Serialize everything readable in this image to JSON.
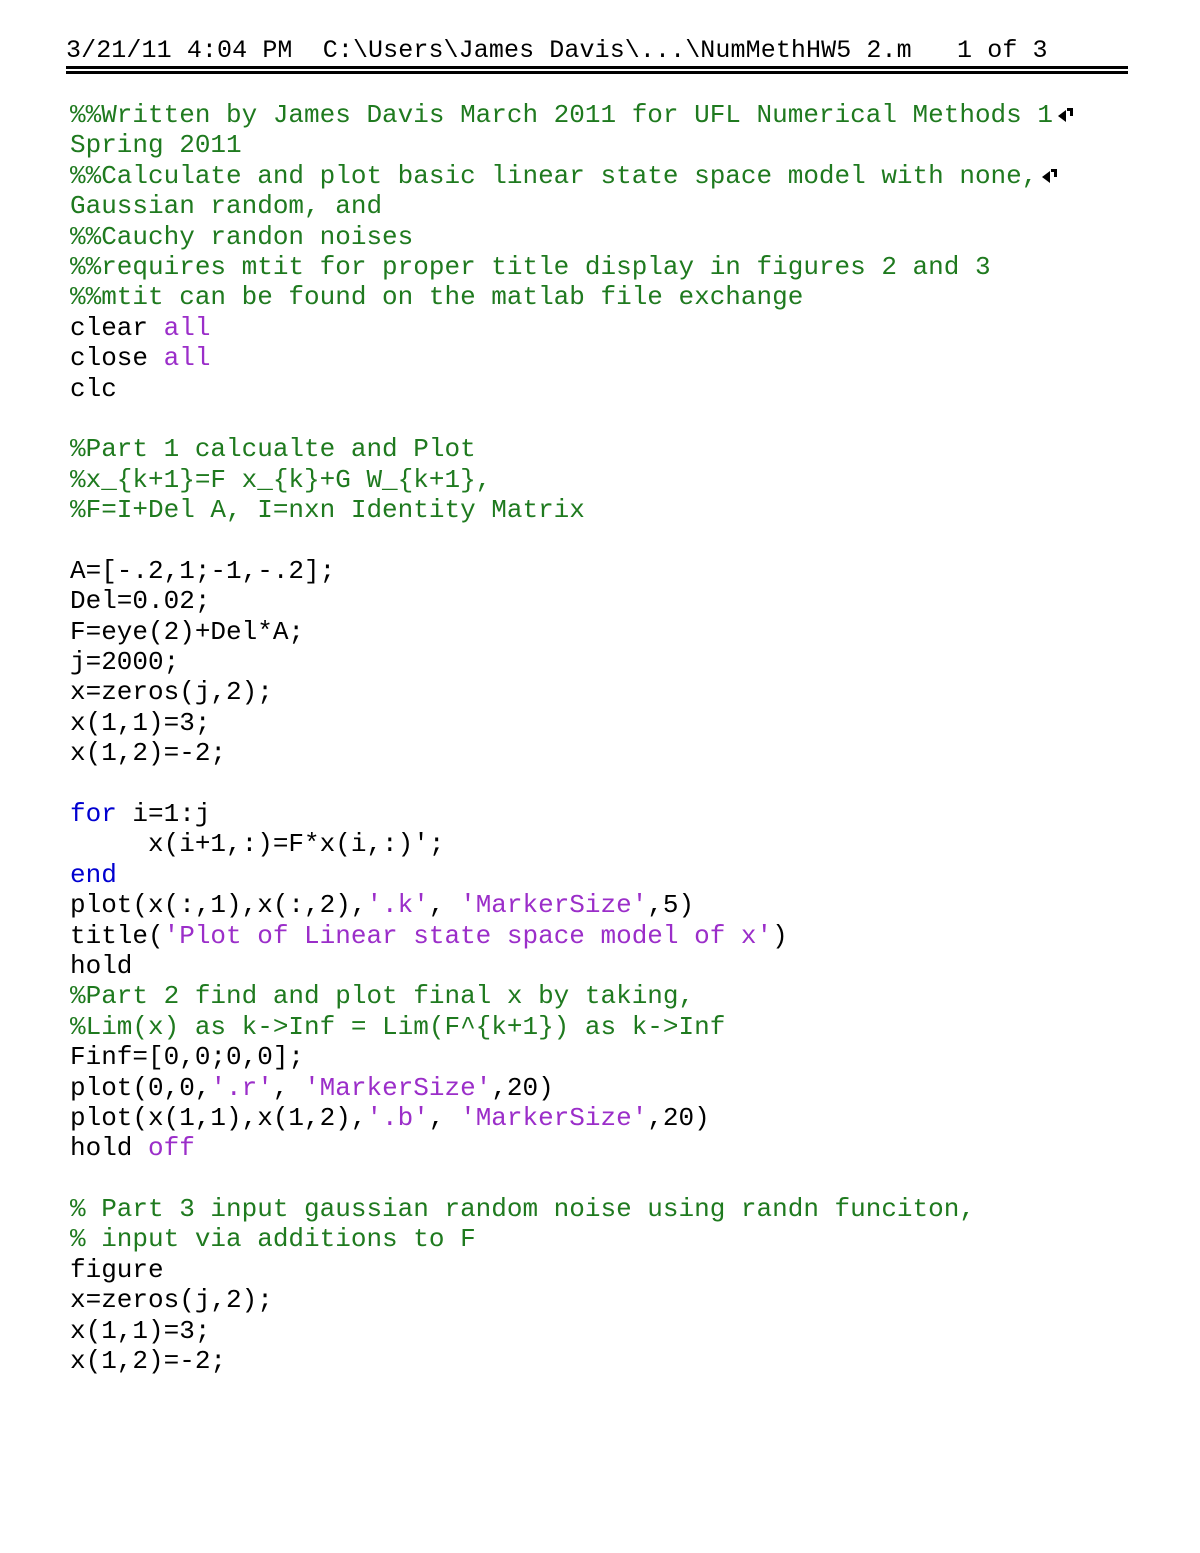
{
  "document": {
    "type": "matlab-source-listing",
    "page_label": "1 of 3",
    "header": {
      "text": "3/21/11 4:04 PM  C:\\Users\\James Davis\\...\\NumMethHW5 2.m   1 of 3",
      "date": "3/21/11",
      "time": "4:04 PM",
      "path": "C:\\Users\\James Davis\\...\\NumMethHW5 2.m",
      "page_number": "1 of 3"
    },
    "colors": {
      "comment": "#1f7a1f",
      "keyword": "#0000d0",
      "string": "#9b2ec9",
      "plain": "#000000",
      "background": "#ffffff",
      "rule": "#000000"
    }
  },
  "code_lines": [
    {
      "id": 1,
      "indent": 0,
      "wrap_marker": true,
      "tokens": [
        {
          "t": "comment",
          "s": "%%Written by James Davis March 2011 for UFL Numerical Methods 1"
        }
      ]
    },
    {
      "id": 2,
      "indent": 0,
      "wrap_marker": false,
      "tokens": [
        {
          "t": "comment",
          "s": "Spring 2011"
        }
      ]
    },
    {
      "id": 3,
      "indent": 0,
      "wrap_marker": true,
      "tokens": [
        {
          "t": "comment",
          "s": "%%Calculate and plot basic linear state space model with none,"
        }
      ]
    },
    {
      "id": 4,
      "indent": 0,
      "wrap_marker": false,
      "tokens": [
        {
          "t": "comment",
          "s": "Gaussian random, and"
        }
      ]
    },
    {
      "id": 5,
      "indent": 0,
      "wrap_marker": false,
      "tokens": [
        {
          "t": "comment",
          "s": "%%Cauchy randon noises"
        }
      ]
    },
    {
      "id": 6,
      "indent": 0,
      "wrap_marker": false,
      "tokens": [
        {
          "t": "comment",
          "s": "%%requires mtit for proper title display in figures 2 and 3"
        }
      ]
    },
    {
      "id": 7,
      "indent": 0,
      "wrap_marker": false,
      "tokens": [
        {
          "t": "comment",
          "s": "%%mtit can be found on the matlab file exchange"
        }
      ]
    },
    {
      "id": 8,
      "indent": 0,
      "wrap_marker": false,
      "tokens": [
        {
          "t": "plain",
          "s": "clear "
        },
        {
          "t": "string",
          "s": "all"
        }
      ]
    },
    {
      "id": 9,
      "indent": 0,
      "wrap_marker": false,
      "tokens": [
        {
          "t": "plain",
          "s": "close "
        },
        {
          "t": "string",
          "s": "all"
        }
      ]
    },
    {
      "id": 10,
      "indent": 0,
      "wrap_marker": false,
      "tokens": [
        {
          "t": "plain",
          "s": "clc"
        }
      ]
    },
    {
      "id": 11,
      "indent": 0,
      "wrap_marker": false,
      "tokens": [
        {
          "t": "plain",
          "s": ""
        }
      ]
    },
    {
      "id": 12,
      "indent": 0,
      "wrap_marker": false,
      "tokens": [
        {
          "t": "comment",
          "s": "%Part 1 calcualte and Plot"
        }
      ]
    },
    {
      "id": 13,
      "indent": 0,
      "wrap_marker": false,
      "tokens": [
        {
          "t": "comment",
          "s": "%x_{k+1}=F x_{k}+G W_{k+1},"
        }
      ]
    },
    {
      "id": 14,
      "indent": 0,
      "wrap_marker": false,
      "tokens": [
        {
          "t": "comment",
          "s": "%F=I+Del A, I=nxn Identity Matrix"
        }
      ]
    },
    {
      "id": 15,
      "indent": 0,
      "wrap_marker": false,
      "tokens": [
        {
          "t": "plain",
          "s": ""
        }
      ]
    },
    {
      "id": 16,
      "indent": 0,
      "wrap_marker": false,
      "tokens": [
        {
          "t": "plain",
          "s": "A=[-.2,1;-1,-.2];"
        }
      ]
    },
    {
      "id": 17,
      "indent": 0,
      "wrap_marker": false,
      "tokens": [
        {
          "t": "plain",
          "s": "Del=0.02;"
        }
      ]
    },
    {
      "id": 18,
      "indent": 0,
      "wrap_marker": false,
      "tokens": [
        {
          "t": "plain",
          "s": "F=eye(2)+Del*A;"
        }
      ]
    },
    {
      "id": 19,
      "indent": 0,
      "wrap_marker": false,
      "tokens": [
        {
          "t": "plain",
          "s": "j=2000;"
        }
      ]
    },
    {
      "id": 20,
      "indent": 0,
      "wrap_marker": false,
      "tokens": [
        {
          "t": "plain",
          "s": "x=zeros(j,2);"
        }
      ]
    },
    {
      "id": 21,
      "indent": 0,
      "wrap_marker": false,
      "tokens": [
        {
          "t": "plain",
          "s": "x(1,1)=3;"
        }
      ]
    },
    {
      "id": 22,
      "indent": 0,
      "wrap_marker": false,
      "tokens": [
        {
          "t": "plain",
          "s": "x(1,2)=-2;"
        }
      ]
    },
    {
      "id": 23,
      "indent": 0,
      "wrap_marker": false,
      "tokens": [
        {
          "t": "plain",
          "s": ""
        }
      ]
    },
    {
      "id": 24,
      "indent": 0,
      "wrap_marker": false,
      "tokens": [
        {
          "t": "keyword",
          "s": "for"
        },
        {
          "t": "plain",
          "s": " i=1:j"
        }
      ]
    },
    {
      "id": 25,
      "indent": 0,
      "wrap_marker": false,
      "tokens": [
        {
          "t": "plain",
          "s": "     x(i+1,:)=F*x(i,:)';"
        }
      ]
    },
    {
      "id": 26,
      "indent": 0,
      "wrap_marker": false,
      "tokens": [
        {
          "t": "keyword",
          "s": "end"
        }
      ]
    },
    {
      "id": 27,
      "indent": 0,
      "wrap_marker": false,
      "tokens": [
        {
          "t": "plain",
          "s": "plot(x(:,1),x(:,2),"
        },
        {
          "t": "string",
          "s": "'.k'"
        },
        {
          "t": "plain",
          "s": ", "
        },
        {
          "t": "string",
          "s": "'MarkerSize'"
        },
        {
          "t": "plain",
          "s": ",5)"
        }
      ]
    },
    {
      "id": 28,
      "indent": 0,
      "wrap_marker": false,
      "tokens": [
        {
          "t": "plain",
          "s": "title("
        },
        {
          "t": "string",
          "s": "'Plot of Linear state space model of x'"
        },
        {
          "t": "plain",
          "s": ")"
        }
      ]
    },
    {
      "id": 29,
      "indent": 0,
      "wrap_marker": false,
      "tokens": [
        {
          "t": "plain",
          "s": "hold"
        }
      ]
    },
    {
      "id": 30,
      "indent": 0,
      "wrap_marker": false,
      "tokens": [
        {
          "t": "comment",
          "s": "%Part 2 find and plot final x by taking,"
        }
      ]
    },
    {
      "id": 31,
      "indent": 0,
      "wrap_marker": false,
      "tokens": [
        {
          "t": "comment",
          "s": "%Lim(x) as k->Inf = Lim(F^{k+1}) as k->Inf"
        }
      ]
    },
    {
      "id": 32,
      "indent": 0,
      "wrap_marker": false,
      "tokens": [
        {
          "t": "plain",
          "s": "Finf=[0,0;0,0];"
        }
      ]
    },
    {
      "id": 33,
      "indent": 0,
      "wrap_marker": false,
      "tokens": [
        {
          "t": "plain",
          "s": "plot(0,0,"
        },
        {
          "t": "string",
          "s": "'.r'"
        },
        {
          "t": "plain",
          "s": ", "
        },
        {
          "t": "string",
          "s": "'MarkerSize'"
        },
        {
          "t": "plain",
          "s": ",20)"
        }
      ]
    },
    {
      "id": 34,
      "indent": 0,
      "wrap_marker": false,
      "tokens": [
        {
          "t": "plain",
          "s": "plot(x(1,1),x(1,2),"
        },
        {
          "t": "string",
          "s": "'.b'"
        },
        {
          "t": "plain",
          "s": ", "
        },
        {
          "t": "string",
          "s": "'MarkerSize'"
        },
        {
          "t": "plain",
          "s": ",20)"
        }
      ]
    },
    {
      "id": 35,
      "indent": 0,
      "wrap_marker": false,
      "tokens": [
        {
          "t": "plain",
          "s": "hold "
        },
        {
          "t": "string",
          "s": "off"
        }
      ]
    },
    {
      "id": 36,
      "indent": 0,
      "wrap_marker": false,
      "tokens": [
        {
          "t": "plain",
          "s": ""
        }
      ]
    },
    {
      "id": 37,
      "indent": 0,
      "wrap_marker": false,
      "tokens": [
        {
          "t": "comment",
          "s": "% Part 3 input gaussian random noise using randn funciton,"
        }
      ]
    },
    {
      "id": 38,
      "indent": 0,
      "wrap_marker": false,
      "tokens": [
        {
          "t": "comment",
          "s": "% input via additions to F"
        }
      ]
    },
    {
      "id": 39,
      "indent": 0,
      "wrap_marker": false,
      "tokens": [
        {
          "t": "plain",
          "s": "figure"
        }
      ]
    },
    {
      "id": 40,
      "indent": 0,
      "wrap_marker": false,
      "tokens": [
        {
          "t": "plain",
          "s": "x=zeros(j,2);"
        }
      ]
    },
    {
      "id": 41,
      "indent": 0,
      "wrap_marker": false,
      "tokens": [
        {
          "t": "plain",
          "s": "x(1,1)=3;"
        }
      ]
    },
    {
      "id": 42,
      "indent": 0,
      "wrap_marker": false,
      "tokens": [
        {
          "t": "plain",
          "s": "x(1,2)=-2;"
        }
      ]
    }
  ]
}
